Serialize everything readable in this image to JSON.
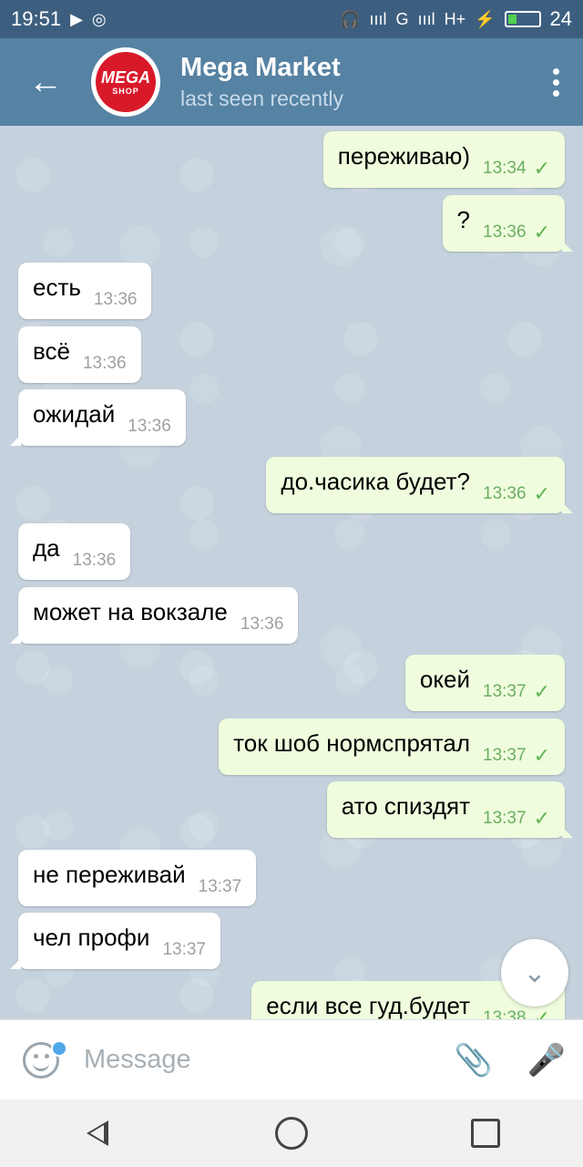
{
  "status_bar": {
    "time": "19:51",
    "play_glyph": "▶",
    "instagram_glyph": "◎",
    "headphones_glyph": "🎧",
    "signal_text": "ıııl",
    "net1": "G",
    "net2": "H+",
    "bolt_glyph": "⚡",
    "battery_level": "24"
  },
  "header": {
    "chat_name": "Mega Market",
    "status": "last seen recently",
    "avatar_line1": "MEGA",
    "avatar_line2": "SHOP"
  },
  "messages": [
    {
      "text": "переживаю)",
      "time": "13:34",
      "dir": "out",
      "check": "✓"
    },
    {
      "text": "?",
      "time": "13:36",
      "dir": "out",
      "check": "✓"
    },
    {
      "text": "есть",
      "time": "13:36",
      "dir": "in"
    },
    {
      "text": "всё",
      "time": "13:36",
      "dir": "in"
    },
    {
      "text": "ожидай",
      "time": "13:36",
      "dir": "in"
    },
    {
      "text": "до.часика будет?",
      "time": "13:36",
      "dir": "out",
      "check": "✓"
    },
    {
      "text": "да",
      "time": "13:36",
      "dir": "in"
    },
    {
      "text": "может на вокзале",
      "time": "13:36",
      "dir": "in"
    },
    {
      "text": "окей",
      "time": "13:37",
      "dir": "out",
      "check": "✓"
    },
    {
      "text": "ток шоб нормспрятал",
      "time": "13:37",
      "dir": "out",
      "check": "✓"
    },
    {
      "text": "ато спиздят",
      "time": "13:37",
      "dir": "out",
      "check": "✓"
    },
    {
      "text": "не переживай",
      "time": "13:37",
      "dir": "in"
    },
    {
      "text": "чел профи",
      "time": "13:37",
      "dir": "in"
    },
    {
      "text": "если все гуд.будет",
      "time": "13:38",
      "dir": "out",
      "check": "✓"
    }
  ],
  "composer": {
    "placeholder": "Message"
  },
  "icons": {
    "back": "←",
    "scroll_down": "⌄",
    "attach": "📎",
    "mic": "🎤"
  }
}
